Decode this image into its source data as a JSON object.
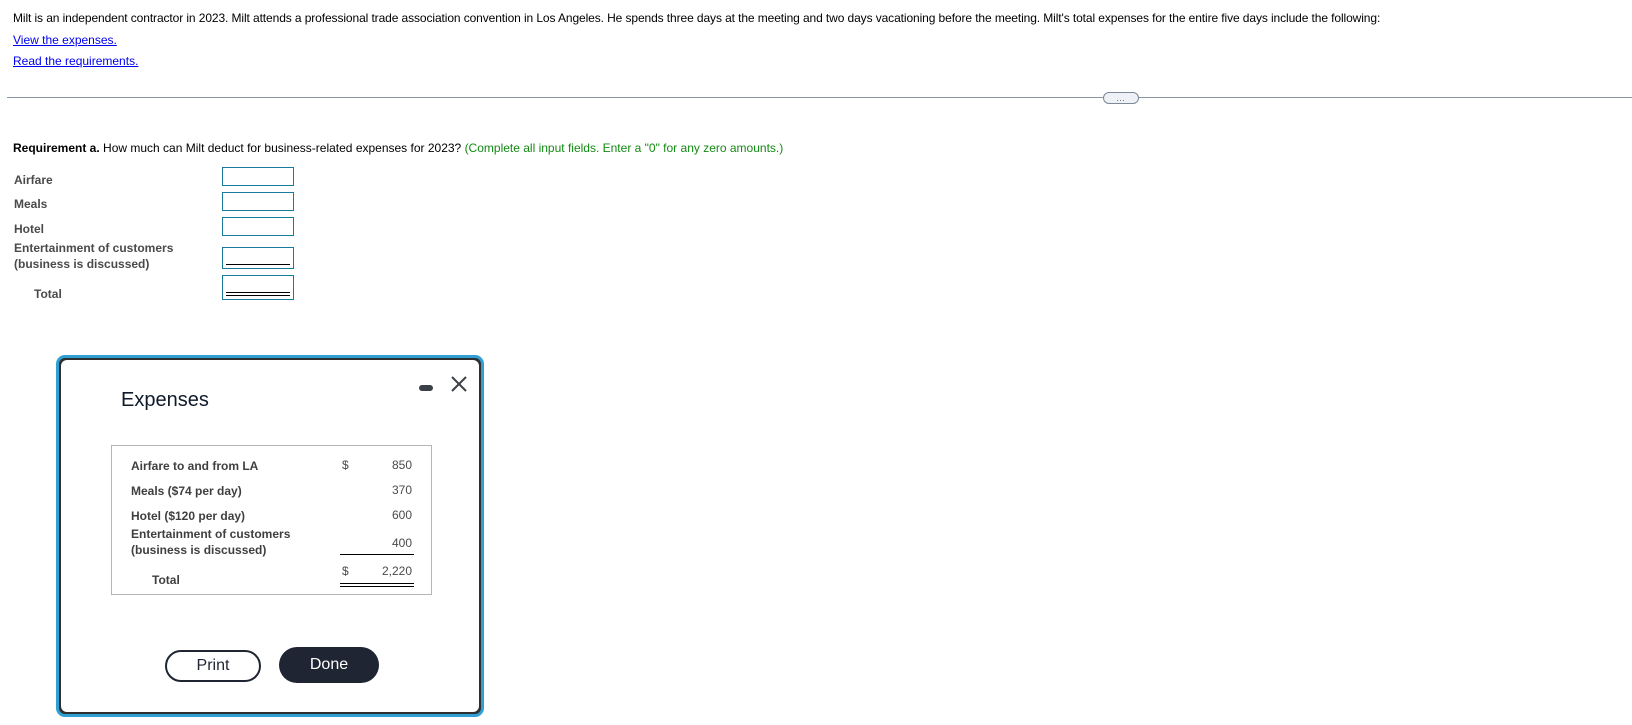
{
  "intro": {
    "text": "Milt is an independent contractor in 2023. Milt attends a professional trade association convention in Los Angeles. He spends three days at the meeting and two days vacationing before the meeting. Milt's total expenses for the entire five days include the following:",
    "links": {
      "view_expenses": "View the expenses.",
      "read_requirements": "Read the requirements."
    }
  },
  "divider": {
    "handle_label": "…"
  },
  "requirement": {
    "label": "Requirement a.",
    "question": " How much can Milt deduct for business-related expenses for 2023? ",
    "hint": "(Complete all input fields. Enter a \"0\" for any zero amounts.)",
    "accent_color": "#138a13",
    "rows": [
      {
        "label": "Airfare",
        "value": ""
      },
      {
        "label": "Meals",
        "value": ""
      },
      {
        "label": "Hotel",
        "value": ""
      },
      {
        "label_line1": "Entertainment of customers",
        "label_line2": "(business is discussed)",
        "value": ""
      },
      {
        "label": "Total",
        "value": ""
      }
    ]
  },
  "modal": {
    "title": "Expenses",
    "border_color": "#2f9fd4",
    "rows": [
      {
        "label": "Airfare to and from LA",
        "currency": "$",
        "value": "850"
      },
      {
        "label": "Meals ($74 per day)",
        "currency": "",
        "value": "370"
      },
      {
        "label": "Hotel ($120 per day)",
        "currency": "",
        "value": "600"
      },
      {
        "label_line1": "Entertainment of customers",
        "label_line2": "(business is discussed)",
        "currency": "",
        "value": "400"
      },
      {
        "label": "Total",
        "currency": "$",
        "value": "2,220"
      }
    ],
    "buttons": {
      "print": "Print",
      "done": "Done"
    }
  }
}
